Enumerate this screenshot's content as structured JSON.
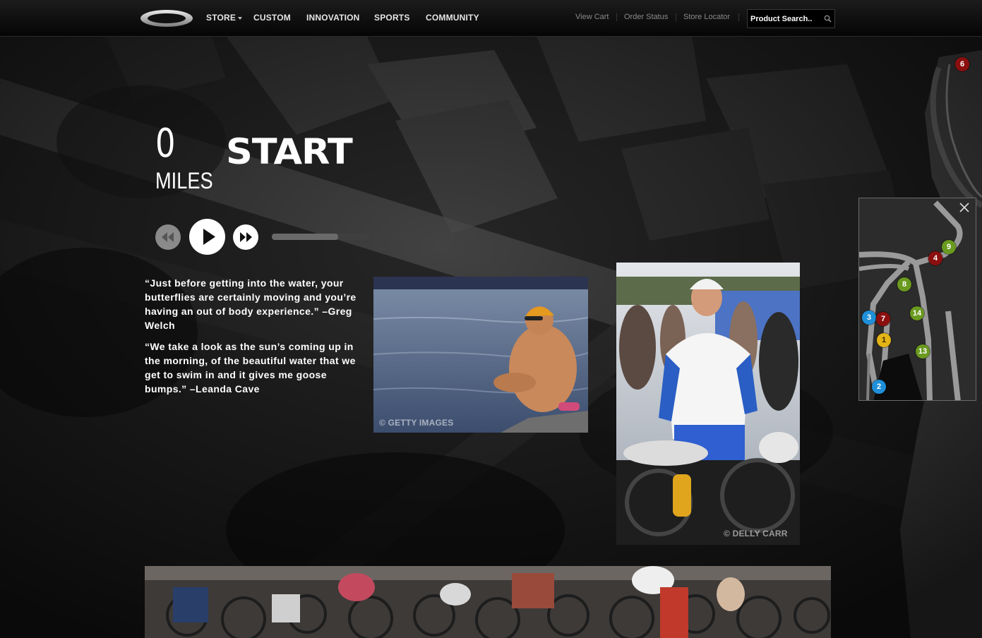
{
  "nav": {
    "items": [
      {
        "label": "STORE",
        "has_caret": true
      },
      {
        "label": "CUSTOM"
      },
      {
        "label": "INNOVATION"
      },
      {
        "label": "SPORTS"
      },
      {
        "label": "COMMUNITY"
      }
    ],
    "utility": [
      "View Cart",
      "Order Status",
      "Store Locator"
    ],
    "search_placeholder": "Product Search.."
  },
  "hero": {
    "distance_value": "0",
    "distance_unit": "MILES",
    "stage_title": "START"
  },
  "player": {
    "progress_fraction": 0.68
  },
  "quotes": [
    "“Just before getting into the water, your butterflies are certainly moving and you’re having an out of body experience.” –Greg Welch",
    "“We take a look as the sun’s coming up in the morning, of the beautiful water that we get to swim in and it gives me goose bumps.” –Leanda Cave"
  ],
  "photos": {
    "swimmer_credit": "© GETTY IMAGES",
    "athlete_credit": "© DELLY CARR"
  },
  "course_map": {
    "edge_marker": "6",
    "markers": [
      {
        "label": "9",
        "color": "green"
      },
      {
        "label": "4",
        "color": "red"
      },
      {
        "label": "8",
        "color": "green"
      },
      {
        "label": "3",
        "color": "blue"
      },
      {
        "label": "7",
        "color": "red"
      },
      {
        "label": "14",
        "color": "green"
      },
      {
        "label": "1",
        "color": "yellow"
      },
      {
        "label": "13",
        "color": "green"
      },
      {
        "label": "2",
        "color": "blue"
      }
    ]
  },
  "colors": {
    "marker_green": "#6a9a1f",
    "marker_red": "#8b0f0f",
    "marker_blue": "#1e8fd8",
    "marker_yellow": "#e4b417"
  }
}
